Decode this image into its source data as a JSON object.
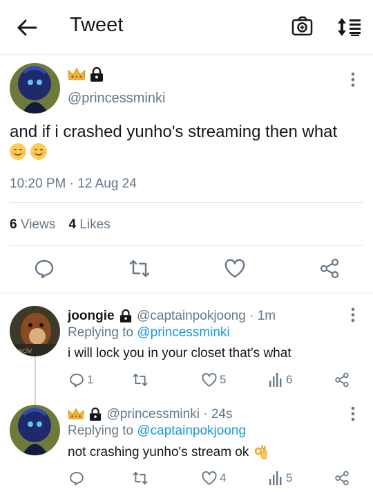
{
  "header": {
    "title": "Tweet"
  },
  "tweet": {
    "handle": "@princessminki",
    "text": "and if i crashed yunho's streaming then what",
    "timestamp": "10:20 PM · 12 Aug 24",
    "views_count": "6",
    "views_label": "Views",
    "likes_count": "4",
    "likes_label": "Likes"
  },
  "replies": [
    {
      "name": "joongie",
      "handle": "@captainpokjoong",
      "time": "· 1m",
      "replying_prefix": "Replying to",
      "replying_to": "@princessminki",
      "text": "i will lock you in your closet that's what",
      "reply_count": "1",
      "like_count": "5",
      "view_count": "6"
    },
    {
      "handle": "@princessminki",
      "time": "· 24s",
      "replying_prefix": "Replying to",
      "replying_to": "@captainpokjoong",
      "text": "not crashing yunho's stream ok",
      "like_count": "4",
      "view_count": "5"
    }
  ],
  "colors": {
    "accent": "#1b95e0",
    "muted": "#657786",
    "divider": "#e1e8ed"
  }
}
